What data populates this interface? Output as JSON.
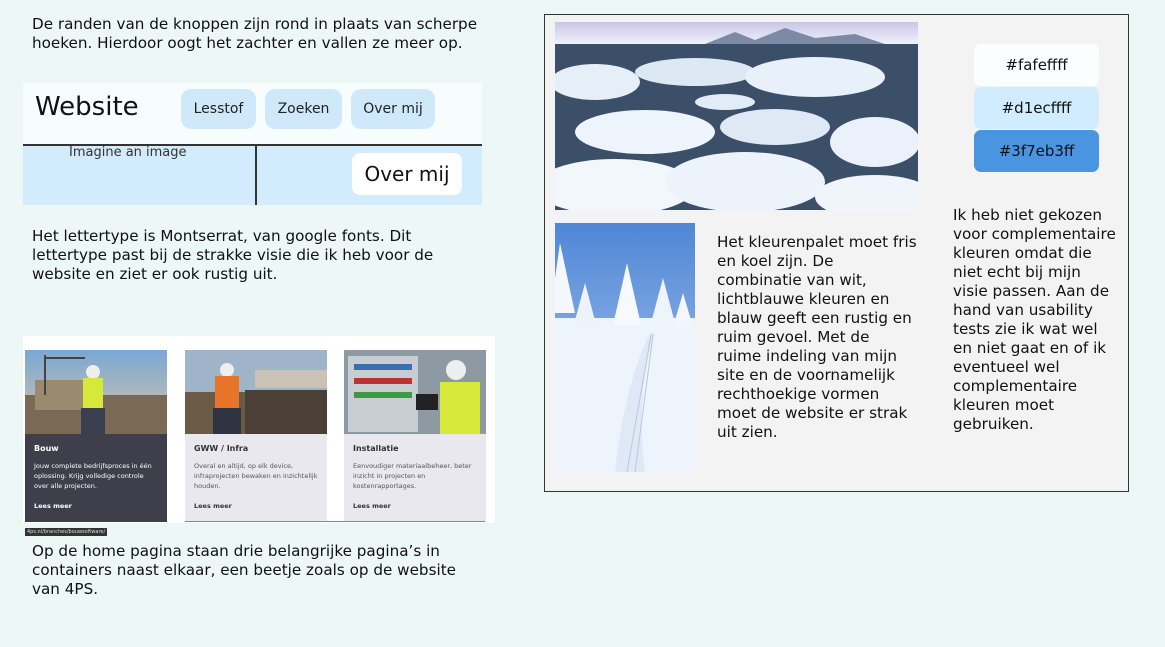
{
  "texts": {
    "buttons_rounded": "De randen van de knoppen zijn rond in plaats van scherpe hoeken. Hierdoor oogt het zachter en vallen ze meer op.",
    "font_choice": "Het lettertype is Montserrat, van google fonts. Dit lettertype past bij de strakke visie die ik heb voor de website en ziet er ook rustig uit.",
    "home_containers": "Op de home pagina staan drie belangrijke pagina’s in containers naast elkaar, een beetje zoals op de website van 4PS.",
    "palette_description": "Het kleurenpalet moet fris en koel zijn. De combinatie van wit, lichtblauwe kleuren en blauw geeft een rustig en ruim gevoel. Met de ruime indeling van mijn site en de voornamelijk rechthoekige vormen moet de website er strak uit zien.",
    "complementary_note": "Ik heb niet gekozen voor complementaire kleuren omdat die niet echt bij mijn visie passen. Aan de hand van usability tests zie ik wat wel en niet gaat en of ik eventueel wel complementaire kleuren moet gebruiken."
  },
  "mockup": {
    "logo": "Website",
    "nav": [
      "Lesstof",
      "Zoeken",
      "Over mij"
    ],
    "image_label": "Imagine an image",
    "big_button": "Over mij"
  },
  "cards": [
    {
      "title": "Bouw",
      "text": "Jouw complete bedrijfsproces in één oplossing. Krijg volledige controle over alle projecten.",
      "link": "Lees meer"
    },
    {
      "title": "GWW / Infra",
      "text": "Overal en altijd, op elk device, infraprojecten bewaken en inzichtelijk houden.",
      "link": "Lees meer"
    },
    {
      "title": "Installatie",
      "text": "Eenvoudiger materiaalbeheer, beter inzicht in projecten en kostenrapportages.",
      "link": "Lees meer"
    }
  ],
  "cards_url": "4ps.nl/branches/bouwsoftware/",
  "palette": [
    {
      "label": "#fafeffff",
      "color": "#fafeff"
    },
    {
      "label": "#d1ecffff",
      "color": "#d1ecff"
    },
    {
      "label": "#3f7eb3ff",
      "color": "#4a95e2"
    }
  ]
}
